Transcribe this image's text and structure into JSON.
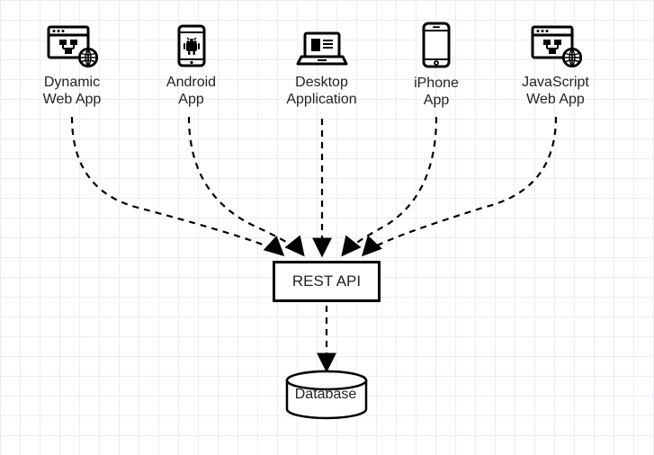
{
  "diagram": {
    "clients": [
      {
        "line1": "Dynamic",
        "line2": "Web App"
      },
      {
        "line1": "Android",
        "line2": "App"
      },
      {
        "line1": "Desktop",
        "line2": "Application"
      },
      {
        "line1": "iPhone",
        "line2": "App"
      },
      {
        "line1": "JavaScript",
        "line2": "Web App"
      }
    ],
    "rest_label": "REST API",
    "database_label": "Database"
  }
}
